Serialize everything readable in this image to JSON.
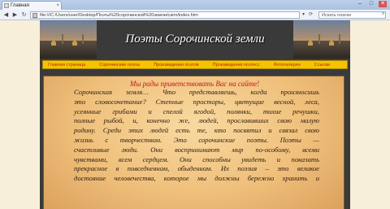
{
  "browser": {
    "tab_title": "Главная",
    "address": "file:///C:/Users/user/Desktop/Поэты%20сорочинской%20земли/cairn/index.htm",
    "search_placeholder": "Искать плагин",
    "window_buttons": [
      "–",
      "□",
      "✕"
    ],
    "icons": [
      "back-icon",
      "forward-icon",
      "reload-icon",
      "search-icon"
    ]
  },
  "header": {
    "title": "Поэты Сорочинской земли"
  },
  "menu": {
    "items": [
      "Главная страница",
      "Сорочинские поэты",
      "Произведения поэтов",
      "Произведения поэтесс",
      "Фотогалерея",
      "Ссылки"
    ]
  },
  "content": {
    "welcome": "Мы рады приветствовать Вас на сайте!",
    "lines": [
      "Сорочинская земля… Что представляешь, когда произносишь",
      "это словосочетание? Степные просторы, цветущие весной, леса,",
      "усеянные грибами и спелой ягодой, полянки, тихие речушки,",
      "полные рыбой, и, конечно же, людей, прославивших свою малую",
      "родину. Среди этих людей есть те, кто посвятил и связал свою",
      "жизнь с творчеством. Это сорочинские поэты. Поэты —",
      "счастливые люди. Они воспринимают мир по-особому, всеми",
      "чувствами, всем сердцем. Они способны увидеть и показать",
      "прекрасное в повседневном, обыденном. Их поэзия – это великое",
      "достояние человечества, которое мы должны бережно хранить и"
    ]
  }
}
